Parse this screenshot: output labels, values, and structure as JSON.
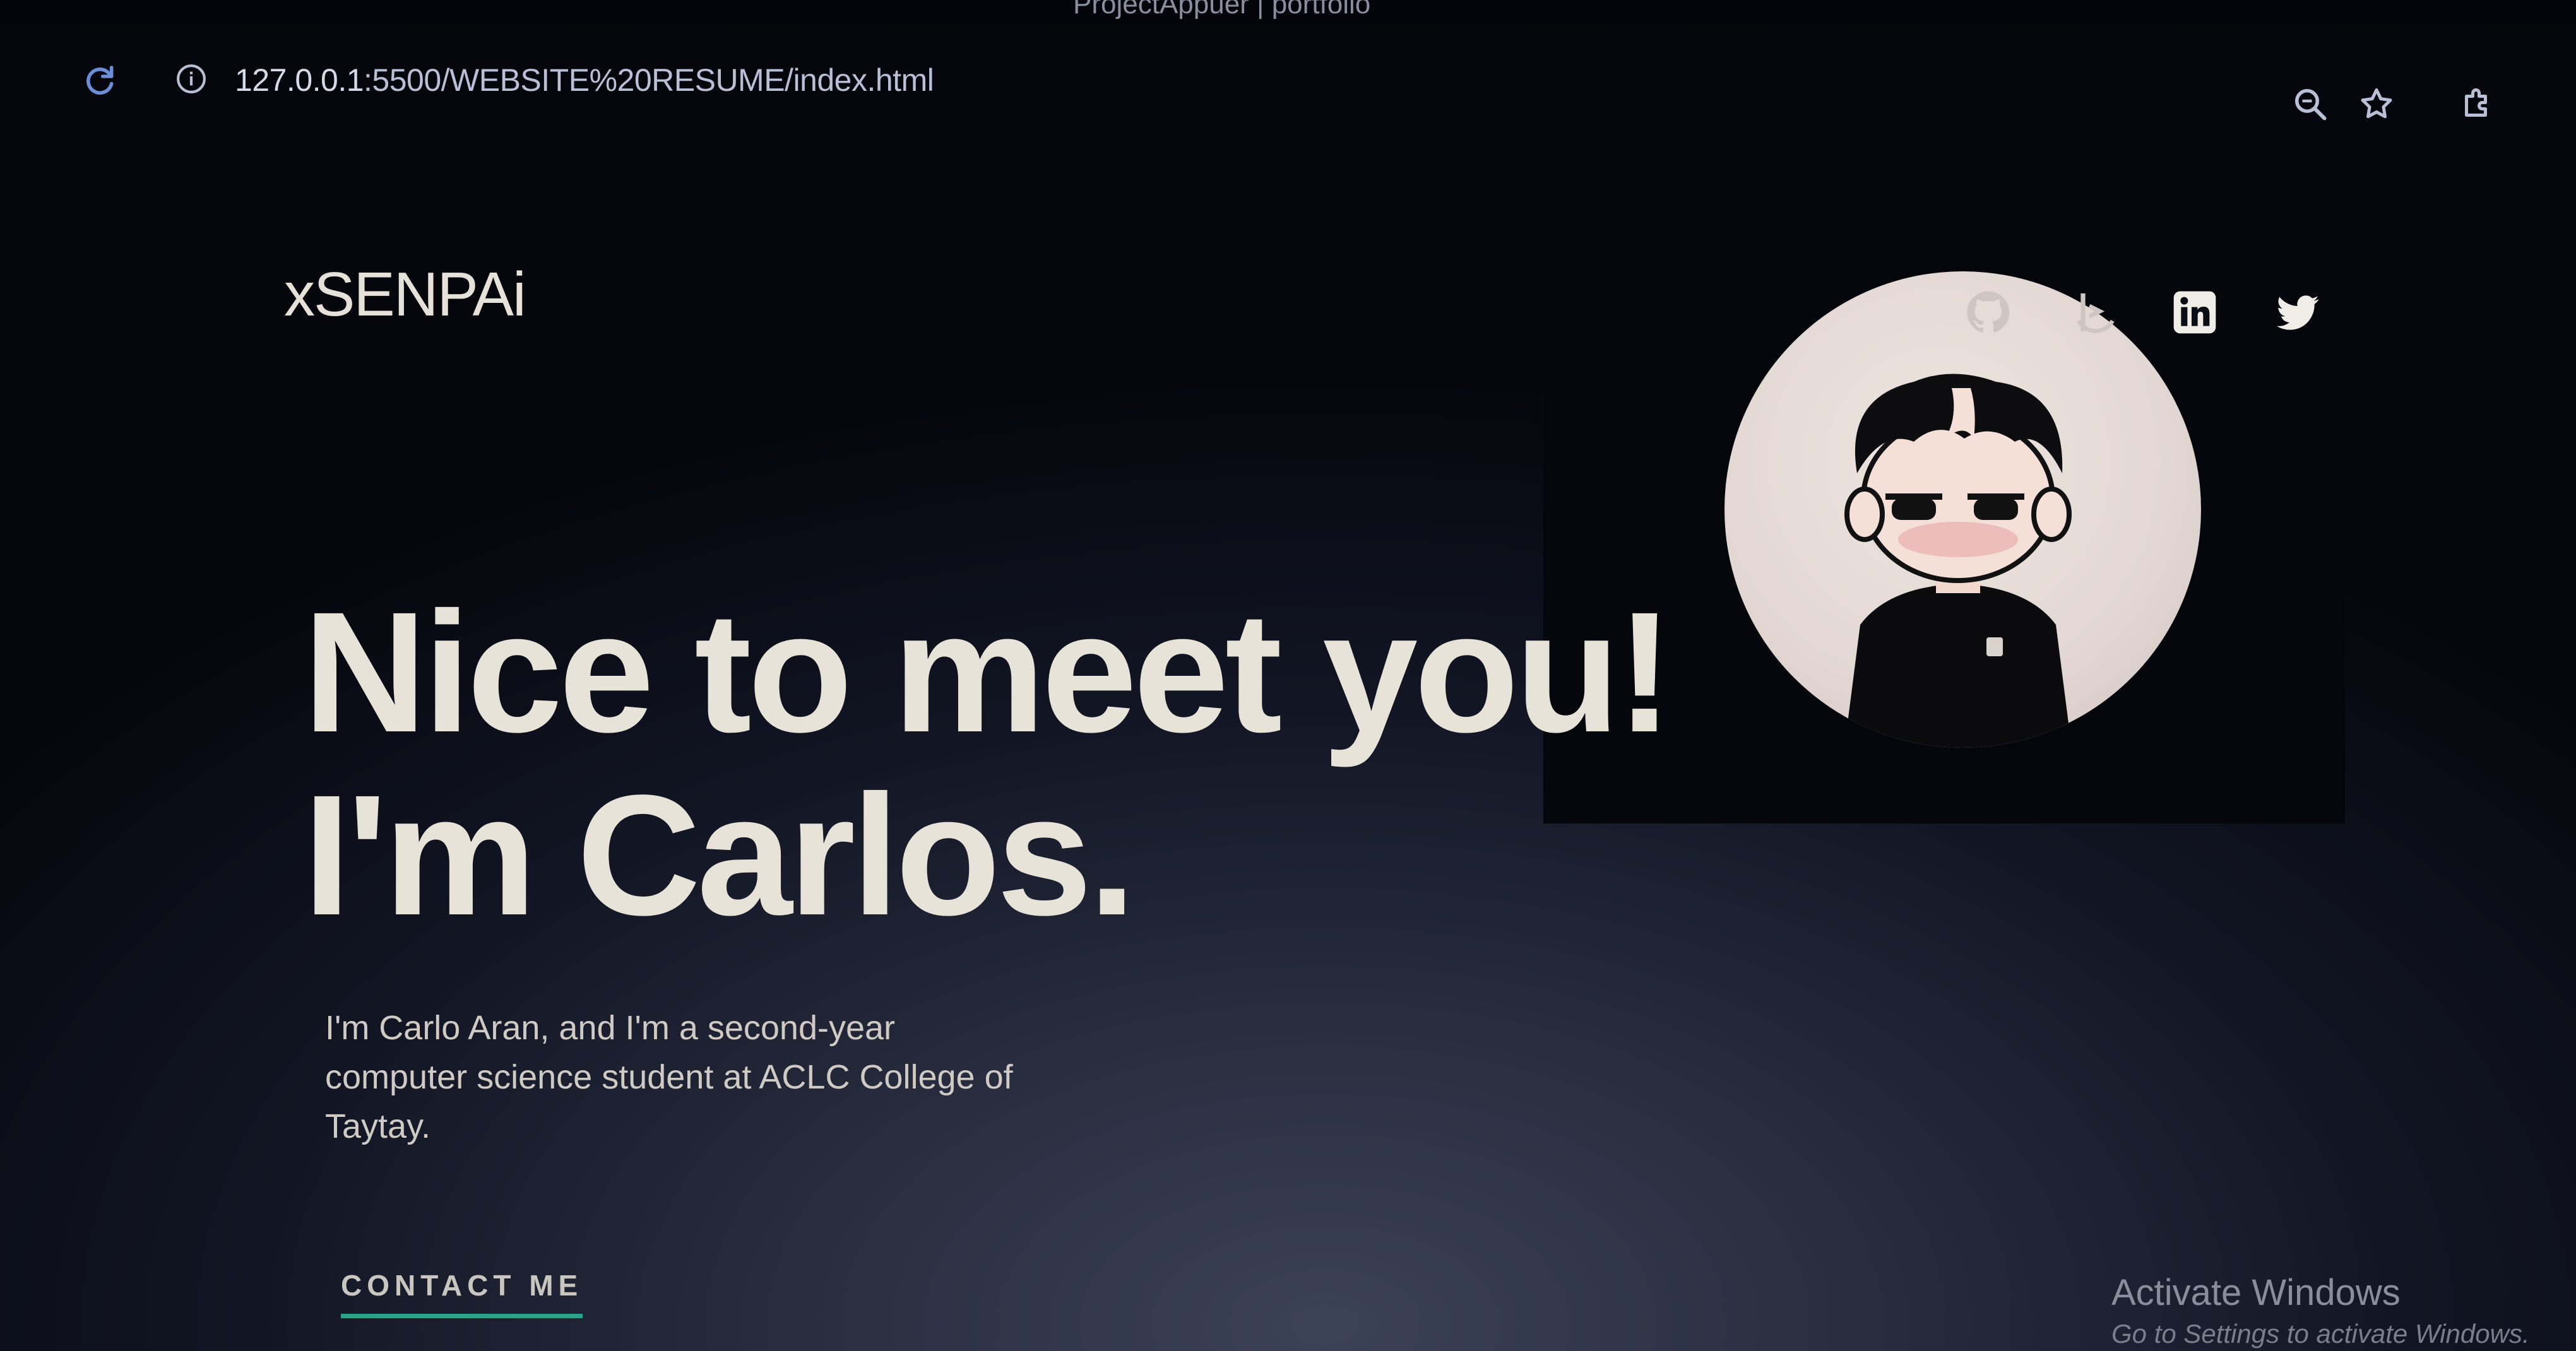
{
  "browser": {
    "tab_title": "ProjectAppuer | portfolio",
    "url_host": "127.0.0.1",
    "url_rest": ":5500/WEBSITE%20RESUME/index.html"
  },
  "site": {
    "logo": "xSENPAi",
    "headline_line1": "Nice to meet you!",
    "headline_line2": "I'm Carlos.",
    "intro": "I'm Carlo Aran, and I'm a second-year computer science student at ACLC College of Taytay.",
    "contact_label": "CONTACT ME"
  },
  "social": {
    "icons": [
      "github-icon",
      "frontend-mentor-icon",
      "linkedin-icon",
      "twitter-icon"
    ]
  },
  "watermark": {
    "title": "Activate Windows",
    "subtitle": "Go to Settings to activate Windows."
  },
  "colors": {
    "accent_underline": "#2aa38a",
    "background": "#05070d",
    "headline": "#e8e3d8"
  }
}
